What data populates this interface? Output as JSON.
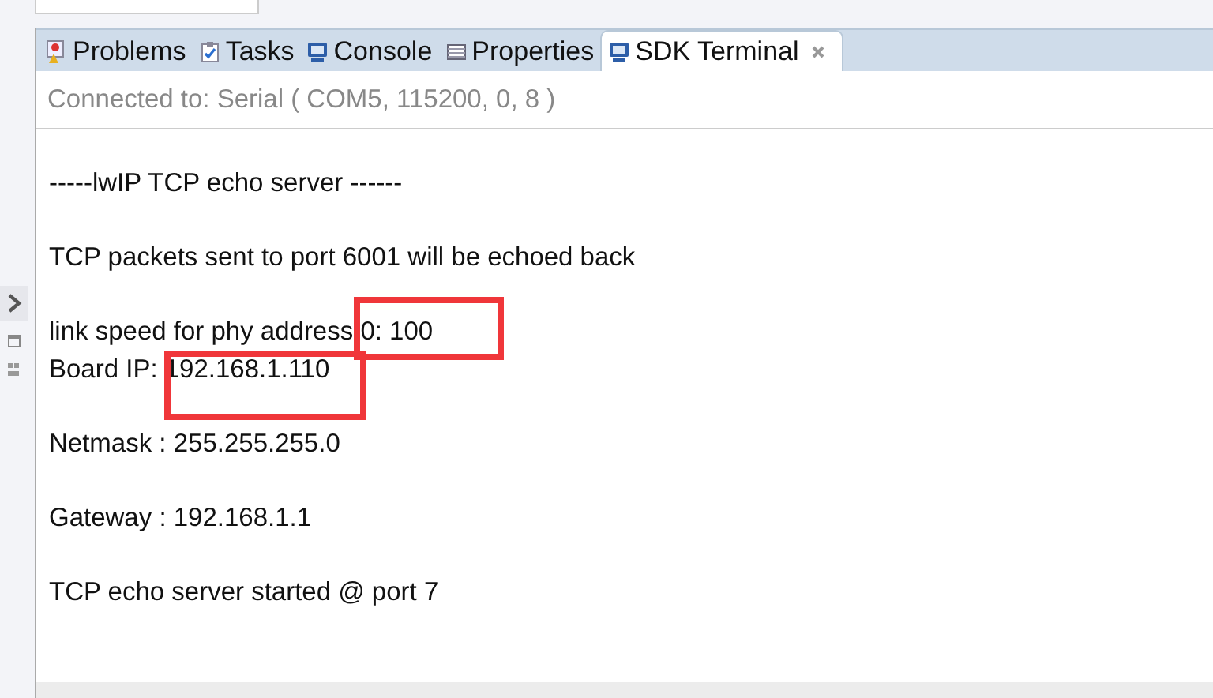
{
  "tabs": [
    {
      "label": "Problems",
      "selected": false
    },
    {
      "label": "Tasks",
      "selected": false
    },
    {
      "label": "Console",
      "selected": false
    },
    {
      "label": "Properties",
      "selected": false
    },
    {
      "label": "SDK Terminal",
      "selected": true
    }
  ],
  "status": "Connected to: Serial (  COM5, 115200, 0, 8 )",
  "output": [
    [
      "-----lwIP TCP echo server ------"
    ],
    [
      "TCP packets sent to port 6001 will be echoed back"
    ],
    [
      "link speed for phy address 0: 100",
      "Board IP: 192.168.1.110"
    ],
    [
      "Netmask : 255.255.255.0"
    ],
    [
      "Gateway : 192.168.1.1"
    ],
    [
      "TCP echo server started @ port 7"
    ]
  ],
  "annotations": [
    {
      "kind": "box"
    },
    {
      "kind": "box"
    }
  ]
}
